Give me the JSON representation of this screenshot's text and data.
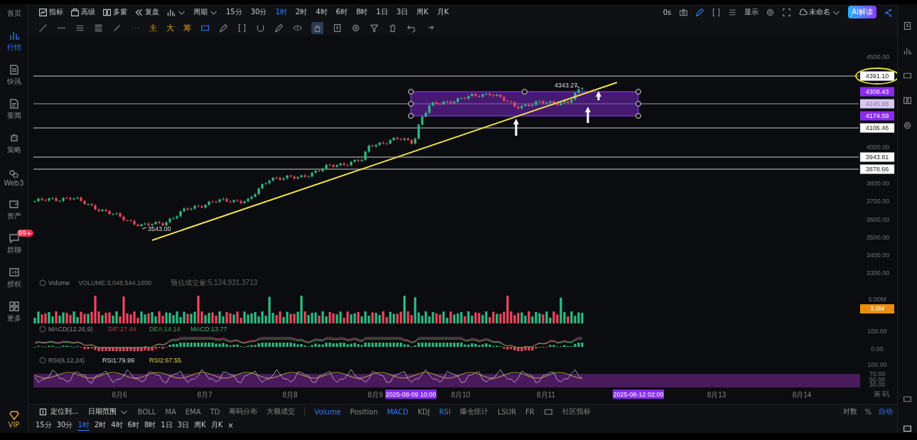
{
  "sidebar": {
    "items": [
      {
        "label": "首页",
        "selected": false
      },
      {
        "label": "行情",
        "selected": true
      },
      {
        "label": "快讯",
        "selected": false
      },
      {
        "label": "要闻",
        "selected": false
      },
      {
        "label": "策略",
        "selected": false
      },
      {
        "label": "Web3",
        "selected": false
      },
      {
        "label": "资产",
        "selected": false
      },
      {
        "label": "群聊",
        "selected": false,
        "badge": "99+"
      },
      {
        "label": "授权",
        "selected": false
      },
      {
        "label": "更多",
        "selected": false
      }
    ],
    "vip": "VIP"
  },
  "toolbar": {
    "tools": [
      {
        "label": "指标"
      },
      {
        "label": "高级"
      },
      {
        "label": "多窗"
      },
      {
        "label": "复盘"
      }
    ],
    "period_menu": "周期",
    "intervals": [
      {
        "label": "15分",
        "selected": false
      },
      {
        "label": "30分",
        "selected": false
      },
      {
        "label": "1时",
        "selected": true
      },
      {
        "label": "2时",
        "selected": false
      },
      {
        "label": "4时",
        "selected": false
      },
      {
        "label": "6时",
        "selected": false
      },
      {
        "label": "8时",
        "selected": false
      },
      {
        "label": "1日",
        "selected": false
      },
      {
        "label": "3日",
        "selected": false
      },
      {
        "label": "周K",
        "selected": false
      },
      {
        "label": "月K",
        "selected": false
      }
    ],
    "timer": "0s",
    "display": "显示",
    "layout_name": "未命名",
    "ai_button": "AI解读"
  },
  "drawing_tools": {
    "markers": [
      "主",
      "大",
      "筹"
    ]
  },
  "chart": {
    "price_ticks": [
      "4500.00",
      "4000.00",
      "3800.00",
      "3700.00",
      "3600.00",
      "3500.00",
      "3400.00",
      "3300.00"
    ],
    "levels": [
      {
        "label": "4391.10",
        "kind": "line",
        "highlighted": true
      },
      {
        "label": "4308.43",
        "kind": "band"
      },
      {
        "label": "4245.98",
        "kind": "mid"
      },
      {
        "label": "4174.59",
        "kind": "band"
      },
      {
        "label": "4106.46",
        "kind": "line",
        "highlighted": false
      },
      {
        "label": "3943.81",
        "kind": "line",
        "highlighted": false
      },
      {
        "label": "3878.66",
        "kind": "line",
        "highlighted": false
      }
    ],
    "high_marker": "4343.27",
    "low_marker": "3543.00",
    "x_labels": [
      {
        "label": "8月6",
        "kind": "date"
      },
      {
        "label": "8月7",
        "kind": "date"
      },
      {
        "label": "8月8",
        "kind": "date"
      },
      {
        "label": "8月9",
        "kind": "date"
      },
      {
        "label": "2025-08-09 10:00",
        "kind": "crosshair"
      },
      {
        "label": "8月10",
        "kind": "date"
      },
      {
        "label": "8月11",
        "kind": "date"
      },
      {
        "label": "2025-08-12 02:00",
        "kind": "crosshair"
      },
      {
        "label": "8月13",
        "kind": "date"
      },
      {
        "label": "8月14",
        "kind": "date"
      }
    ],
    "corner_label": "筹 码"
  },
  "volume": {
    "name": "Volume",
    "value": "VOLUME:3,048,544.1600",
    "estimate": "预估成交量:5,124,931.3713",
    "axis": "5.00M",
    "current": "3.0M"
  },
  "macd": {
    "name": "MACD(12,26,9)",
    "dif": "DIF:27.44",
    "dea": "DEA:14.14",
    "macd": "MACD:13.77",
    "axis": [
      "100.00",
      "0.00"
    ]
  },
  "rsi": {
    "name": "RSI(6,12,24)",
    "rsi1": "RSI1:79.99",
    "rsi2": "RSI2:67.55",
    "axis": [
      "100.00",
      "70.00",
      "50.00",
      "30.00"
    ]
  },
  "indicator_bar": {
    "locate": "定位到...",
    "date_range": "日期范围",
    "tabs": [
      {
        "label": "BOLL",
        "selected": false
      },
      {
        "label": "MA",
        "selected": false
      },
      {
        "label": "EMA",
        "selected": false
      },
      {
        "label": "TD",
        "selected": false
      },
      {
        "label": "筹码分布",
        "selected": false
      },
      {
        "label": "大额成交",
        "selected": false
      },
      {
        "label": "Volume",
        "selected": true
      },
      {
        "label": "Position",
        "selected": false
      },
      {
        "label": "MACD",
        "selected": true
      },
      {
        "label": "KDJ",
        "selected": false
      },
      {
        "label": "RSI",
        "selected": true
      },
      {
        "label": "爆仓统计",
        "selected": false
      },
      {
        "label": "LSUR",
        "selected": false
      },
      {
        "label": "FR",
        "selected": false
      },
      {
        "label": "社区指标",
        "selected": false
      }
    ],
    "scale": [
      {
        "label": "对数",
        "selected": false
      },
      {
        "label": "%",
        "selected": false
      },
      {
        "label": "自动",
        "selected": true
      }
    ]
  },
  "timeframes": [
    {
      "label": "15分",
      "selected": false
    },
    {
      "label": "30分",
      "selected": false
    },
    {
      "label": "1时",
      "selected": true
    },
    {
      "label": "2时",
      "selected": false
    },
    {
      "label": "4时",
      "selected": false
    },
    {
      "label": "6时",
      "selected": false
    },
    {
      "label": "8时",
      "selected": false
    },
    {
      "label": "1日",
      "selected": false
    },
    {
      "label": "3日",
      "selected": false
    },
    {
      "label": "周K",
      "selected": false
    },
    {
      "label": "月K",
      "selected": false
    }
  ],
  "close_label": "×"
}
